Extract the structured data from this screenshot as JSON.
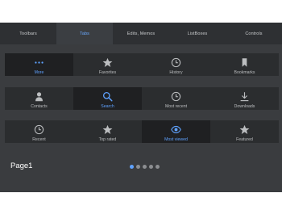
{
  "top_tabs": [
    {
      "label": "Toolbars"
    },
    {
      "label": "Tabs"
    },
    {
      "label": "Edits, Memos"
    },
    {
      "label": "ListBoxes"
    },
    {
      "label": "Controls"
    }
  ],
  "tabbars": [
    [
      {
        "label": "More",
        "icon": "more-icon"
      },
      {
        "label": "Favorites",
        "icon": "star-icon"
      },
      {
        "label": "History",
        "icon": "clock-icon"
      },
      {
        "label": "Bookmarks",
        "icon": "bookmark-icon"
      }
    ],
    [
      {
        "label": "Contacts",
        "icon": "person-icon"
      },
      {
        "label": "Search",
        "icon": "search-icon"
      },
      {
        "label": "Most recent",
        "icon": "clock-icon"
      },
      {
        "label": "Downloads",
        "icon": "download-icon"
      }
    ],
    [
      {
        "label": "Recent",
        "icon": "clock-icon"
      },
      {
        "label": "Top rated",
        "icon": "star-icon"
      },
      {
        "label": "Most viewed",
        "icon": "eye-icon"
      },
      {
        "label": "Featured",
        "icon": "star-icon"
      }
    ]
  ],
  "page": {
    "label": "Page1"
  },
  "colors": {
    "accent": "#5fa2ff",
    "background": "#3a3c3f",
    "tabbar": "#2b2d2f",
    "selected": "#1f2022"
  }
}
